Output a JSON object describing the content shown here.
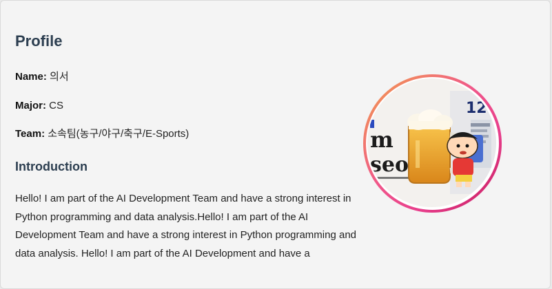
{
  "profile": {
    "title": "Profile",
    "fields": {
      "name": {
        "label": "Name:",
        "value": "의서"
      },
      "major": {
        "label": "Major:",
        "value": "CS"
      },
      "team": {
        "label": "Team:",
        "value": "소속팀(농구/야구/축구/E-Sports)"
      }
    },
    "introduction_heading": "Introduction",
    "introduction_text": "Hello! I am part of the AI Development Team and have a strong interest in Python programming and data analysis.Hello! I am part of the AI Development Team and have a strong interest in Python programming and data analysis. Hello! I am part of the AI Development and have a"
  },
  "avatar": {
    "ring_colors": [
      "#f2a14a",
      "#f0578a",
      "#c2185b"
    ],
    "image_subject": "beer-mug-and-cartoon-character-sticker",
    "image_text": {
      "text_m": "m",
      "text_seo": "seo",
      "text_number": "12"
    }
  }
}
